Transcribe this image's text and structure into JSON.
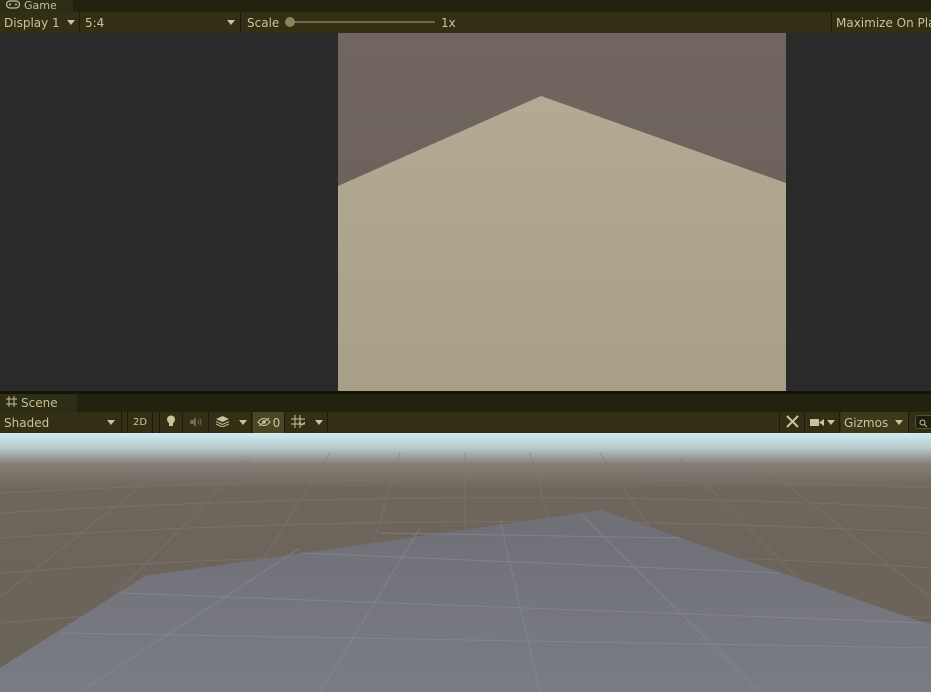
{
  "game": {
    "tab_label": "Game",
    "display_value": "Display 1",
    "aspect_value": "5:4",
    "scale_label": "Scale",
    "scale_value": "1x",
    "maximize_label": "Maximize On Play",
    "icons": {
      "tab": "gamepad-icon"
    }
  },
  "scene": {
    "tab_label": "Scene",
    "shading_mode": "Shaded",
    "mode_2d_label": "2D",
    "hidden_count": "0",
    "gizmos_label": "Gizmos",
    "icons": {
      "tab": "grid-icon",
      "lighting": "lightbulb-icon",
      "audio": "audio-icon",
      "effects": "effects-layers-icon",
      "visibility": "eye-hidden-icon",
      "grid": "grid-snap-icon",
      "tools": "tools-icon",
      "camera": "camera-icon",
      "search": "search-icon"
    }
  },
  "colors": {
    "toolbar_bg": "#332f14",
    "tab_bar_bg": "#23220f",
    "game_view_bg": "#2a2a2a",
    "game_sky": "#6e645f",
    "game_floor": "#aba28a",
    "scene_sky_top": "#c9e6ea",
    "scene_ground": "#6d655c",
    "scene_plane": "#767880"
  }
}
